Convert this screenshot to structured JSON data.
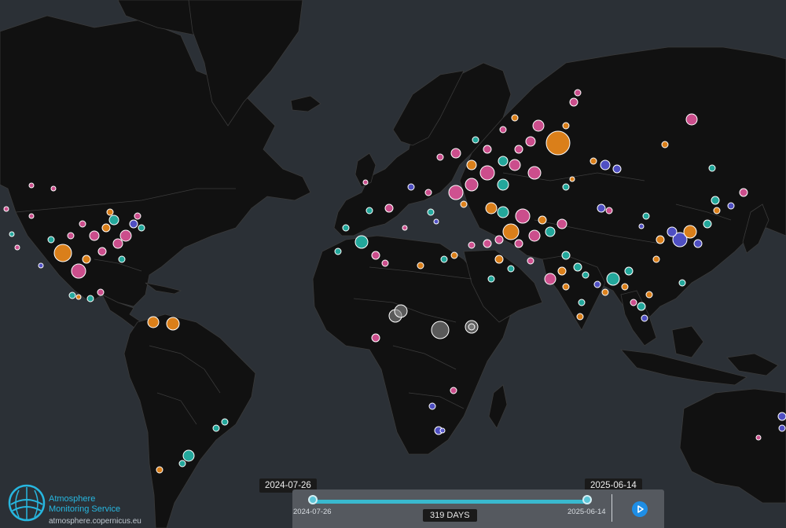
{
  "brand": {
    "name_line1": "Atmosphere",
    "name_line2": "Monitoring Service",
    "url": "atmosphere.copernicus.eu"
  },
  "timeline": {
    "start_date_flag": "2024-07-26",
    "end_date_flag": "2025-06-14",
    "start_tick": "2024-07-26",
    "end_tick": "2025-06-14",
    "duration": "319 DAYS",
    "range_fill": 1.0
  },
  "colors": {
    "ocean": "#2b3036",
    "land": "#111111",
    "pink": "#e0559a",
    "orange": "#f18c1c",
    "teal": "#26b8ab",
    "blue": "#5656d6",
    "grey": "#8a8a8a",
    "accent": "#1e8ee6"
  },
  "icons": {
    "logo": "globe-logo-icon",
    "play": "play-icon"
  }
}
